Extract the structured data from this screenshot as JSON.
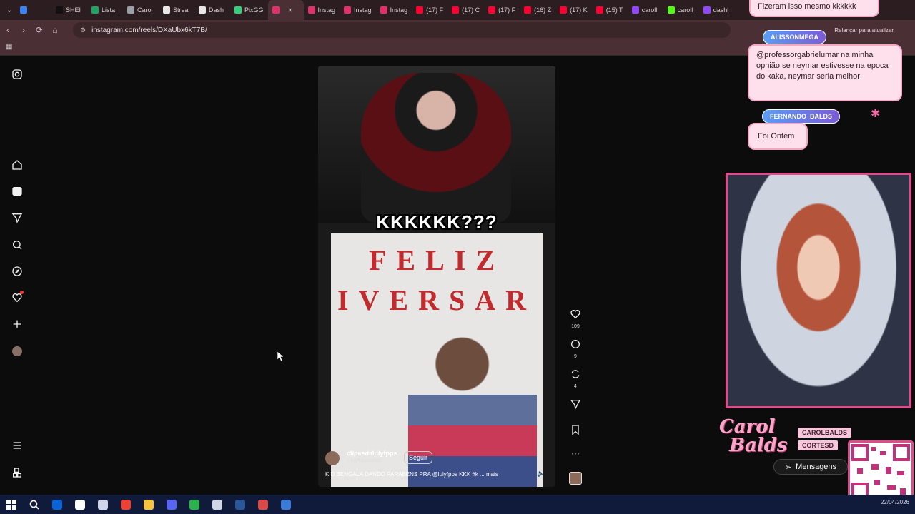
{
  "browser": {
    "tabs": [
      {
        "label": "",
        "color": "#3b82f6"
      },
      {
        "label": "SHEI",
        "color": "#111111"
      },
      {
        "label": "Lista",
        "color": "#21a366"
      },
      {
        "label": "Carol",
        "color": "#9aa0a6"
      },
      {
        "label": "Strea",
        "color": "#e8e8e8"
      },
      {
        "label": "Dash",
        "color": "#e8e8e8"
      },
      {
        "label": "PixGG",
        "color": "#32d07a"
      },
      {
        "label": "",
        "color": "#e1306c",
        "active": true
      },
      {
        "label": "Instag",
        "color": "#e1306c"
      },
      {
        "label": "Instag",
        "color": "#e1306c"
      },
      {
        "label": "Instag",
        "color": "#e1306c"
      },
      {
        "label": "(17) F",
        "color": "#ff0033"
      },
      {
        "label": "(17) C",
        "color": "#ff0033"
      },
      {
        "label": "(17) F",
        "color": "#ff0033"
      },
      {
        "label": "(16) Z",
        "color": "#ff0033"
      },
      {
        "label": "(17) K",
        "color": "#ff0033"
      },
      {
        "label": "(15) T",
        "color": "#ff0033"
      },
      {
        "label": "caroll",
        "color": "#9146ff"
      },
      {
        "label": "caroll",
        "color": "#53fc18"
      },
      {
        "label": "dashl",
        "color": "#9146ff"
      }
    ],
    "url": "instagram.com/reels/DXaUbx6kT7B/",
    "reload_hint": "Relançar para atualizar"
  },
  "reel": {
    "overlay_text": "KKKKKK???",
    "banner_line1": "FELIZ",
    "banner_line2": "IVERSAR",
    "username": "clipesdalulyfpps",
    "audio": "lulyfppscortes",
    "follow_label": "Seguir",
    "caption": "KID BENGALA DANDO PARABÉNS PRA @lulyfpps KKK #k ... mais",
    "likes": "109",
    "comments": "9",
    "reposts": "4"
  },
  "stream_chat": [
    {
      "name": "",
      "text": "Fizeram isso mesmo kkkkkk"
    },
    {
      "name": "ALISSONMEGA",
      "text": "@professorgabrielumar na minha opnião se neymar estivesse na epoca do kaka, neymar seria melhor"
    },
    {
      "name": "FERNANDO_BALDS",
      "text": "Foi Ontem"
    }
  ],
  "stream_brand": {
    "name_line1": "Carol",
    "name_line2": "Balds",
    "handle1": "CAROLBALDS",
    "handle2": "CORTESD"
  },
  "messages_label": "Mensagens",
  "taskbar": {
    "date": "22/04/2026",
    "apps": [
      "#0a64d8",
      "#ffffff",
      "#cfd6ea",
      "#ea4335",
      "#f5c542",
      "#5865f2",
      "#2bb24c",
      "#d0d6e4",
      "#2b579a",
      "#d94b4b",
      "#3c7bd8"
    ]
  }
}
